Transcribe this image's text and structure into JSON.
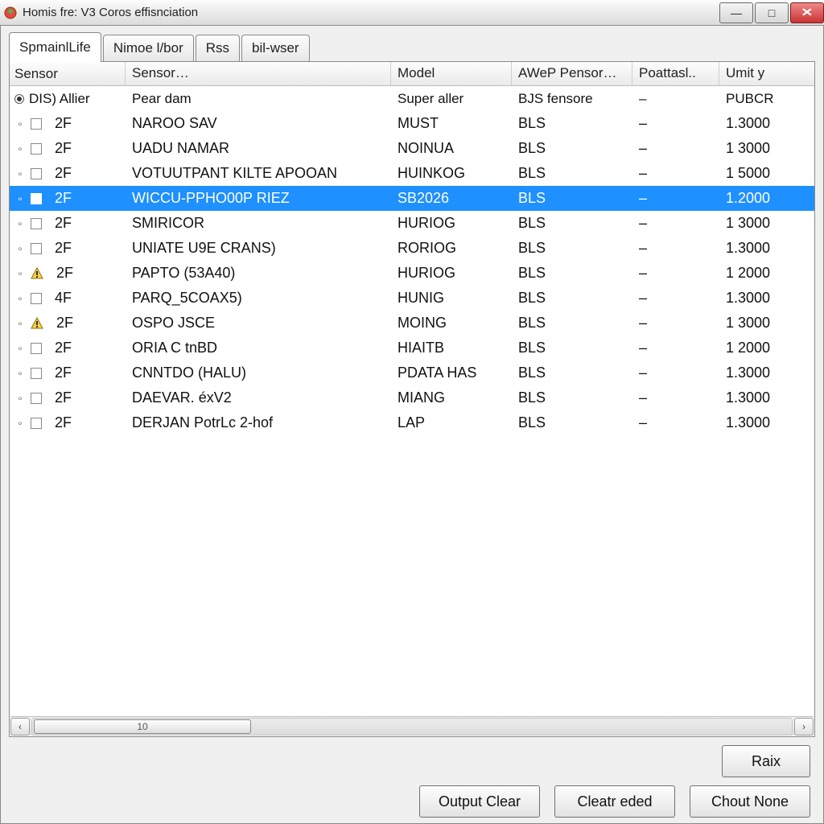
{
  "window": {
    "title": "Homis fre: V3 Coros effisnciation"
  },
  "tabs": [
    {
      "label": "SpmainlLife",
      "active": true
    },
    {
      "label": "Nimoe l/bor",
      "active": false
    },
    {
      "label": "Rss",
      "active": false
    },
    {
      "label": "bil-wser",
      "active": false
    }
  ],
  "columns": [
    "Sensor",
    "Sensor…",
    "Model",
    "AWeP Pensor…",
    "Poattasl..",
    "Umit y"
  ],
  "group_row": {
    "c0": "DIS) Allier",
    "c1": "Pear dam",
    "c2": "Super aller",
    "c3": "BJS fensore",
    "c4": "–",
    "c5": "PUBCR"
  },
  "rows": [
    {
      "icon": "box",
      "c0": "2F",
      "c1": "NAROO SAV",
      "c2": "MUST",
      "c3": "BLS",
      "c4": "–",
      "c5": "1.3000"
    },
    {
      "icon": "box",
      "c0": "2F",
      "c1": "UADU NAMAR",
      "c2": "NOINUA",
      "c3": "BLS",
      "c4": "–",
      "c5": "1 3000"
    },
    {
      "icon": "box",
      "c0": "2F",
      "c1": "VOTUUTPANT KILTE APOOAN",
      "c2": "HUINKOG",
      "c3": "BLS",
      "c4": "–",
      "c5": "1 5000"
    },
    {
      "icon": "sel",
      "c0": "2F",
      "c1": "WICCU-PPHO00P RIEZ",
      "c2": "SB2026",
      "c3": "BLS",
      "c4": "–",
      "c5": "1.2000",
      "selected": true
    },
    {
      "icon": "box",
      "c0": "2F",
      "c1": "SMIRICOR",
      "c2": "HURIOG",
      "c3": "BLS",
      "c4": "–",
      "c5": "1 3000"
    },
    {
      "icon": "box",
      "c0": "2F",
      "c1": "UNIATE U9E CRANS)",
      "c2": "RORIOG",
      "c3": "BLS",
      "c4": "–",
      "c5": "1.3000"
    },
    {
      "icon": "warn",
      "c0": "2F",
      "c1": "PAPTO (53A40)",
      "c2": "HURIOG",
      "c3": "BLS",
      "c4": "–",
      "c5": "1 2000"
    },
    {
      "icon": "box",
      "c0": "4F",
      "c1": "PARQ_5COAX5)",
      "c2": "HUNIG",
      "c3": "BLS",
      "c4": "–",
      "c5": "1.3000"
    },
    {
      "icon": "warn",
      "c0": "2F",
      "c1": "OSPO JSCE",
      "c2": "MOING",
      "c3": "BLS",
      "c4": "–",
      "c5": "1 3000"
    },
    {
      "icon": "box",
      "c0": "2F",
      "c1": "ORIA C tnBD",
      "c2": "HIAITB",
      "c3": "BLS",
      "c4": "–",
      "c5": "1 2000"
    },
    {
      "icon": "box",
      "c0": "2F",
      "c1": "CNNTDO (HALU)",
      "c2": "PDATA HAS",
      "c3": "BLS",
      "c4": "–",
      "c5": "1.3000"
    },
    {
      "icon": "box",
      "c0": "2F",
      "c1": "DAEVAR. éxV2",
      "c2": "MIANG",
      "c3": "BLS",
      "c4": "–",
      "c5": "1.3000"
    },
    {
      "icon": "box",
      "c0": "2F",
      "c1": "DERJAN PotrLc 2-hof",
      "c2": "LAP",
      "c3": "BLS",
      "c4": "–",
      "c5": "1.3000"
    }
  ],
  "scroll": {
    "thumb_label": "10"
  },
  "buttons": {
    "raix": "Raix",
    "output_clear": "Output Clear",
    "cleatr_eded": "Cleatr eded",
    "chout_none": "Chout None"
  }
}
